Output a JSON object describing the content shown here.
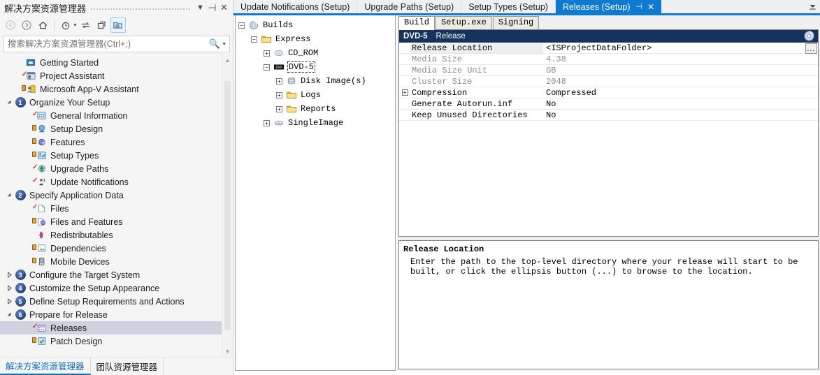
{
  "solution_explorer": {
    "title": "解决方案资源管理器",
    "titlebar_buttons": [
      {
        "name": "dropdown",
        "glyph": "▼"
      },
      {
        "name": "pin",
        "glyph": "⊣"
      },
      {
        "name": "close",
        "glyph": "✕"
      }
    ],
    "toolbar": [
      {
        "name": "back-icon",
        "glyph": "◀",
        "disabled": true
      },
      {
        "name": "forward-icon",
        "glyph": "▶",
        "disabled": true
      },
      {
        "name": "home-icon",
        "glyph": "⌂",
        "disabled": false
      },
      {
        "name": "pending-changes-icon",
        "glyph": "◷",
        "disabled": false,
        "caret": true
      },
      {
        "name": "sync-icon",
        "glyph": "⇄",
        "disabled": false
      },
      {
        "name": "collapse-all-icon",
        "glyph": "❒",
        "disabled": false
      },
      {
        "name": "show-all-files-icon",
        "glyph": "🗀",
        "disabled": false,
        "active": true
      }
    ],
    "search": {
      "placeholder": "搜索解决方案资源管理器(Ctrl+;)",
      "value": "",
      "icon": "search-icon"
    },
    "tree": [
      {
        "label": "Getting Started",
        "indent": 1,
        "twisty": "",
        "icon": "getting-started-icon",
        "check": false,
        "lock": false
      },
      {
        "label": "Project Assistant",
        "indent": 1,
        "twisty": "",
        "icon": "project-assistant-icon",
        "check": true,
        "lock": false
      },
      {
        "label": "Microsoft App-V Assistant",
        "indent": 1,
        "twisty": "",
        "icon": "appv-assistant-icon",
        "check": false,
        "lock": true
      },
      {
        "label": "Organize Your Setup",
        "indent": 0,
        "twisty": "▲",
        "icon": "number-1-icon",
        "number": "1"
      },
      {
        "label": "General Information",
        "indent": 2,
        "twisty": "",
        "icon": "general-information-icon",
        "check": true
      },
      {
        "label": "Setup Design",
        "indent": 2,
        "twisty": "",
        "icon": "setup-design-icon",
        "lock": true
      },
      {
        "label": "Features",
        "indent": 2,
        "twisty": "",
        "icon": "features-icon",
        "lock": true
      },
      {
        "label": "Setup Types",
        "indent": 2,
        "twisty": "",
        "icon": "setup-types-icon",
        "lock": true
      },
      {
        "label": "Upgrade Paths",
        "indent": 2,
        "twisty": "",
        "icon": "upgrade-paths-icon",
        "check": true
      },
      {
        "label": "Update Notifications",
        "indent": 2,
        "twisty": "",
        "icon": "update-notifications-icon",
        "check": true
      },
      {
        "label": "Specify Application Data",
        "indent": 0,
        "twisty": "▲",
        "icon": "number-2-icon",
        "number": "2"
      },
      {
        "label": "Files",
        "indent": 2,
        "twisty": "",
        "icon": "files-icon",
        "check": true
      },
      {
        "label": "Files and Features",
        "indent": 2,
        "twisty": "",
        "icon": "files-and-features-icon",
        "lock": true
      },
      {
        "label": "Redistributables",
        "indent": 2,
        "twisty": "",
        "icon": "redistributables-icon"
      },
      {
        "label": "Dependencies",
        "indent": 2,
        "twisty": "",
        "icon": "dependencies-icon",
        "lock": true
      },
      {
        "label": "Mobile Devices",
        "indent": 2,
        "twisty": "",
        "icon": "mobile-devices-icon",
        "lock": true
      },
      {
        "label": "Configure the Target System",
        "indent": 0,
        "twisty": "▶",
        "icon": "number-3-icon",
        "number": "3"
      },
      {
        "label": "Customize the Setup Appearance",
        "indent": 0,
        "twisty": "▶",
        "icon": "number-4-icon",
        "number": "4"
      },
      {
        "label": "Define Setup Requirements and Actions",
        "indent": 0,
        "twisty": "▶",
        "icon": "number-5-icon",
        "number": "5"
      },
      {
        "label": "Prepare for Release",
        "indent": 0,
        "twisty": "▲",
        "icon": "number-6-icon",
        "number": "6"
      },
      {
        "label": "Releases",
        "indent": 2,
        "twisty": "",
        "icon": "releases-icon",
        "check": true,
        "selected": true
      },
      {
        "label": "Patch Design",
        "indent": 2,
        "twisty": "",
        "icon": "patch-design-icon",
        "lock": true
      }
    ],
    "bottom_tabs": [
      {
        "label": "解决方案资源管理器",
        "active": true
      },
      {
        "label": "团队资源管理器",
        "active": false
      }
    ],
    "scrollbar": {
      "up": "▲",
      "down": "▼"
    }
  },
  "document_tabs": {
    "tabs": [
      {
        "label": "Update Notifications (Setup)",
        "active": false
      },
      {
        "label": "Upgrade Paths (Setup)",
        "active": false
      },
      {
        "label": "Setup Types (Setup)",
        "active": false
      },
      {
        "label": "Releases (Setup)",
        "active": true,
        "pin": "⊣",
        "close": "✕"
      }
    ],
    "overflow_glyph": "▼"
  },
  "builds_tree": {
    "nodes": [
      {
        "label": "Builds",
        "depth": 0,
        "expander": "−",
        "icon": "disc-icon"
      },
      {
        "label": "Express",
        "depth": 1,
        "expander": "−",
        "icon": "folder-icon"
      },
      {
        "label": "CD_ROM",
        "depth": 2,
        "expander": "+",
        "icon": "cd-rom-icon"
      },
      {
        "label": "DVD-5",
        "depth": 2,
        "expander": "−",
        "icon": "dvd-icon",
        "selected": true
      },
      {
        "label": "Disk Image(s)",
        "depth": 3,
        "expander": "+",
        "icon": "disk-image-icon"
      },
      {
        "label": "Logs",
        "depth": 3,
        "expander": "+",
        "icon": "folder-icon"
      },
      {
        "label": "Reports",
        "depth": 3,
        "expander": "+",
        "icon": "folder-icon"
      },
      {
        "label": "SingleImage",
        "depth": 2,
        "expander": "+",
        "icon": "single-image-icon"
      }
    ]
  },
  "property_pane": {
    "tabs": [
      {
        "label": "Build",
        "active": true
      },
      {
        "label": "Setup.exe",
        "active": false
      },
      {
        "label": "Signing",
        "active": false
      }
    ],
    "header": {
      "name": "DVD-5",
      "subtitle": "Release",
      "icon": "disc-icon"
    },
    "rows": [
      {
        "name": "Release Location",
        "value": "<ISProjectDataFolder>",
        "disabled": false,
        "expander": null,
        "ellipsis": true,
        "selected": true
      },
      {
        "name": "Media Size",
        "value": "4.38",
        "disabled": true,
        "expander": null,
        "ellipsis": false
      },
      {
        "name": "Media Size Unit",
        "value": "GB",
        "disabled": true,
        "expander": null,
        "ellipsis": false
      },
      {
        "name": "Cluster Size",
        "value": "2048",
        "disabled": true,
        "expander": null,
        "ellipsis": false
      },
      {
        "name": "Compression",
        "value": "Compressed",
        "disabled": false,
        "expander": "+",
        "ellipsis": false
      },
      {
        "name": "Generate Autorun.inf",
        "value": "No",
        "disabled": false,
        "expander": null,
        "ellipsis": false
      },
      {
        "name": "Keep Unused Directories",
        "value": "No",
        "disabled": false,
        "expander": null,
        "ellipsis": false
      }
    ],
    "description": {
      "title": "Release Location",
      "body": "Enter the path to the top-level directory where your release will start to be built, or click the ellipsis button (...) to browse to the location."
    }
  },
  "colors": {
    "accent_blue": "#0e7bd1",
    "grid_header_navy": "#16335e",
    "selection_gray": "#cfd1de",
    "panel_bg": "#f5f5f5"
  }
}
